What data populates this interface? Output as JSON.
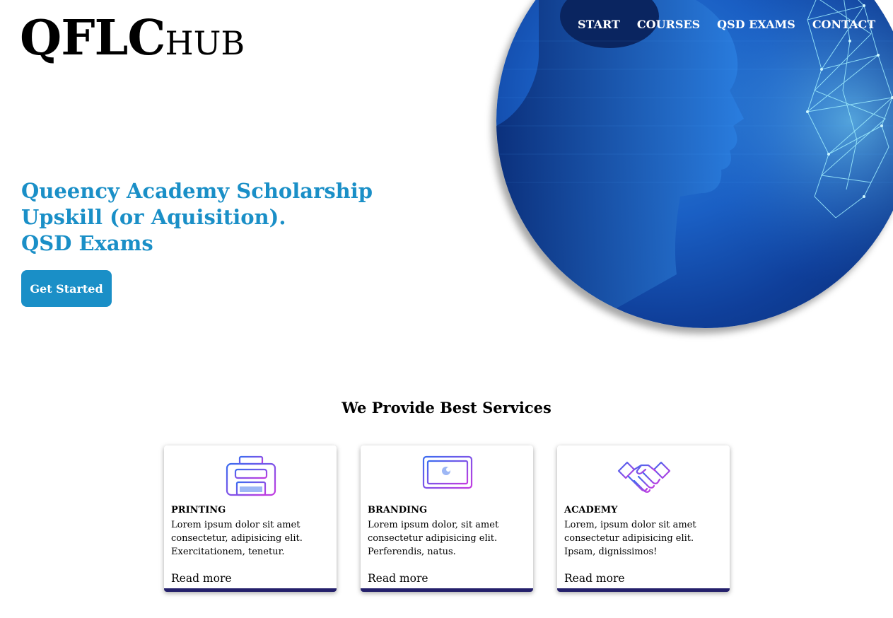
{
  "brand": {
    "logo_big": "QFLC",
    "logo_small": "HUB"
  },
  "nav": [
    {
      "label": "START"
    },
    {
      "label": "COURSES"
    },
    {
      "label": "QSD EXAMS"
    },
    {
      "label": "CONTACT"
    }
  ],
  "hero": {
    "line1": "Queency Academy Scholarship",
    "line2": "Upskill (or Aquisition).",
    "line3": "QSD Exams",
    "cta_label": "Get Started",
    "image_icon": "face-profile-blue-digital-image"
  },
  "services": {
    "heading": "We Provide Best Services",
    "cards": [
      {
        "icon": "printer-icon",
        "title": "PRINTING",
        "text": "Lorem ipsum dolor sit amet consectetur, adipisicing elit. Exercitationem, tenetur.",
        "link": "Read more"
      },
      {
        "icon": "monitor-icon",
        "title": "BRANDING",
        "text": "Lorem ipsum dolor, sit amet consectetur adipisicing elit. Perferendis, natus.",
        "link": "Read more"
      },
      {
        "icon": "handshake-icon",
        "title": "ACADEMY",
        "text": "Lorem, ipsum dolor sit amet consectetur adipisicing elit. Ipsam, dignissimos!",
        "link": "Read more"
      }
    ]
  },
  "colors": {
    "accent": "#1a8fc7",
    "card_bar": "#24206b",
    "icon_gradient_start": "#3b6cf0",
    "icon_gradient_end": "#c23be0"
  }
}
